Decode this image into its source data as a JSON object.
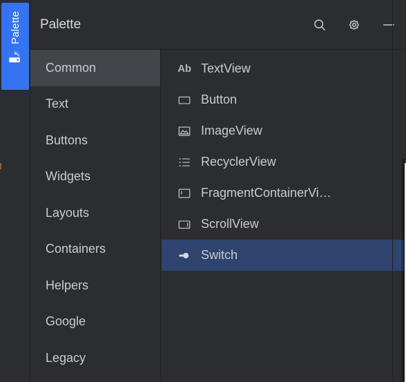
{
  "window": {
    "title": "Palette",
    "tool_tab_label": "Palette",
    "tool_tab_icon": "palette-icon",
    "accent_color": "#3573f0",
    "selection_color": "#2e436e",
    "category_selection_color": "#43454a",
    "background_color": "#2b2d30",
    "text_color": "#c8ccd2"
  },
  "header": {
    "title": "Palette",
    "actions": [
      {
        "name": "search",
        "icon": "search-icon",
        "label": "Search"
      },
      {
        "name": "settings",
        "icon": "gear-icon",
        "label": "Settings"
      },
      {
        "name": "minimize",
        "icon": "minimize-icon",
        "label": "Minimize"
      }
    ]
  },
  "categories": {
    "selected": "Common",
    "items": [
      {
        "label": "Common",
        "selected": true
      },
      {
        "label": "Text",
        "selected": false
      },
      {
        "label": "Buttons",
        "selected": false
      },
      {
        "label": "Widgets",
        "selected": false
      },
      {
        "label": "Layouts",
        "selected": false
      },
      {
        "label": "Containers",
        "selected": false
      },
      {
        "label": "Helpers",
        "selected": false
      },
      {
        "label": "Google",
        "selected": false
      },
      {
        "label": "Legacy",
        "selected": false
      }
    ]
  },
  "widgets": {
    "selected": "Switch",
    "items": [
      {
        "label": "TextView",
        "icon": "text-ab-icon",
        "selected": false
      },
      {
        "label": "Button",
        "icon": "button-rect-icon",
        "selected": false
      },
      {
        "label": "ImageView",
        "icon": "image-icon",
        "selected": false
      },
      {
        "label": "RecyclerView",
        "icon": "list-icon",
        "selected": false
      },
      {
        "label": "FragmentContainerVi…",
        "icon": "fragment-container-icon",
        "selected": false
      },
      {
        "label": "ScrollView",
        "icon": "scrollview-icon",
        "selected": false
      },
      {
        "label": "Switch",
        "icon": "switch-icon",
        "selected": true
      }
    ]
  }
}
